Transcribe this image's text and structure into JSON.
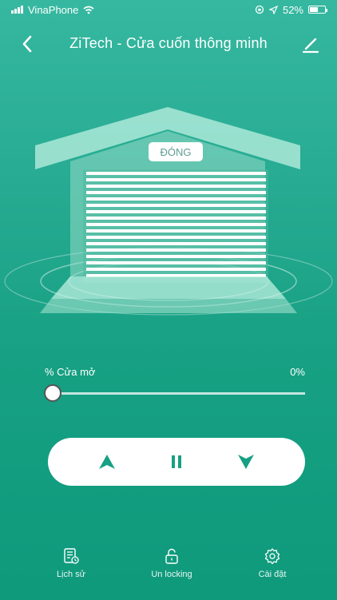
{
  "status_bar": {
    "carrier": "VinaPhone",
    "battery": "52%"
  },
  "header": {
    "title": "ZiTech - Cửa cuốn thông minh"
  },
  "door": {
    "status_label": "ĐÓNG"
  },
  "slider": {
    "label": "% Cửa mở",
    "value_text": "0%",
    "value": 0
  },
  "bottom_nav": {
    "items": [
      {
        "label": "Lịch sử",
        "icon": "history-icon"
      },
      {
        "label": "Un locking",
        "icon": "unlock-icon"
      },
      {
        "label": "Cài đặt",
        "icon": "settings-icon"
      }
    ]
  },
  "colors": {
    "background_top": "#36b8a0",
    "background_bottom": "#0f9a7c",
    "control_icon": "#17a083"
  }
}
